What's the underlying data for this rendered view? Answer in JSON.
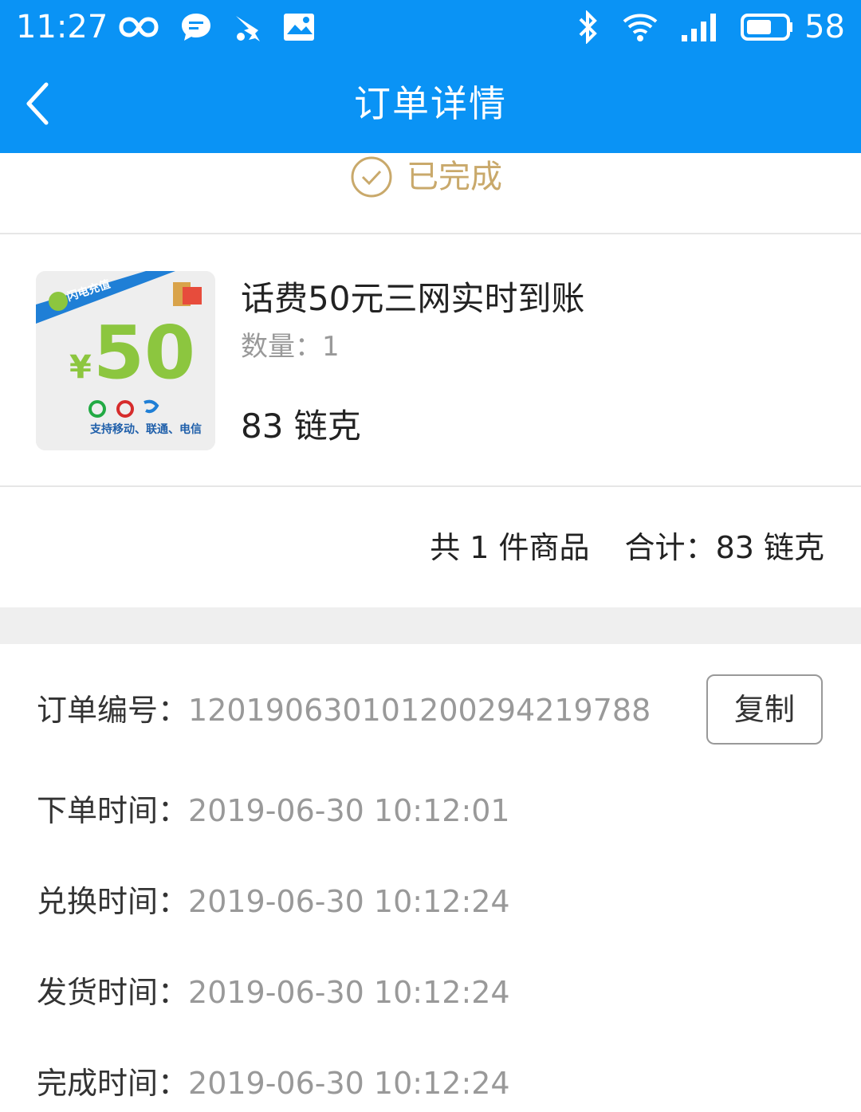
{
  "status_bar": {
    "time": "11:27",
    "battery": "58"
  },
  "nav": {
    "title": "订单详情"
  },
  "order": {
    "status": "已完成",
    "product": {
      "image_amount": "50",
      "image_currency": "¥",
      "image_badge": "闪电充值",
      "image_caption": "支持移动、联通、电信",
      "title": "话费50元三网实时到账",
      "qty_label": "数量：",
      "qty": "1",
      "price": "83 链克"
    },
    "summary": {
      "count_text": "共 1 件商品",
      "total_label": "合计：",
      "total_value": "83 链克"
    },
    "info": [
      {
        "label": "订单编号：",
        "value": "120190630101200294219788"
      },
      {
        "label": "下单时间：",
        "value": "2019-06-30 10:12:01"
      },
      {
        "label": "兑换时间：",
        "value": "2019-06-30 10:12:24"
      },
      {
        "label": "发货时间：",
        "value": "2019-06-30 10:12:24"
      },
      {
        "label": "完成时间：",
        "value": "2019-06-30 10:12:24"
      }
    ],
    "copy_label": "复制"
  },
  "colors": {
    "primary": "#0a93f5",
    "status_gold": "#c9a96b",
    "gray_text": "#999999",
    "band": "#efefef"
  }
}
